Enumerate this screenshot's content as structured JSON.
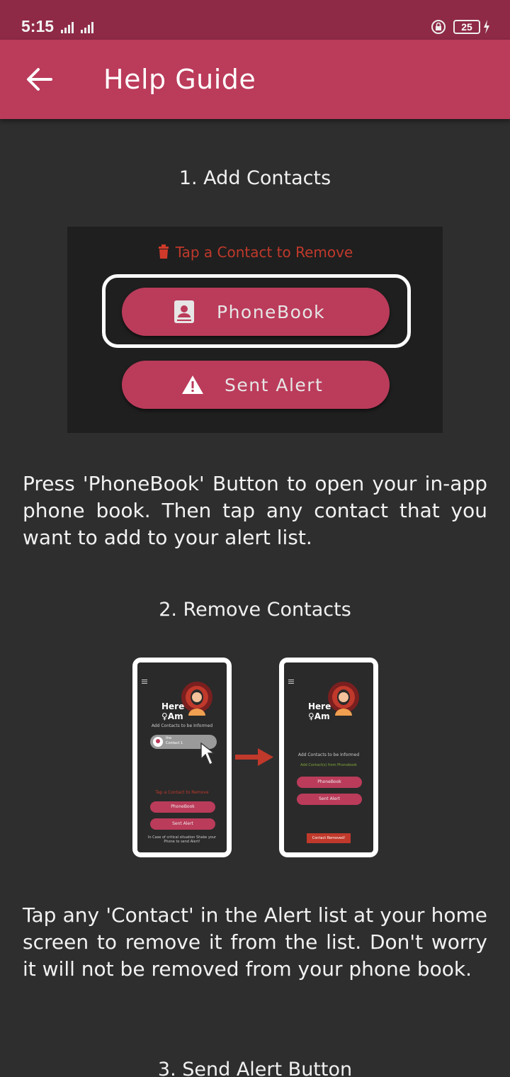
{
  "status": {
    "time": "5:15",
    "battery": "25"
  },
  "appbar": {
    "title": "Help Guide"
  },
  "sections": [
    {
      "heading": "1. Add Contacts",
      "figure": {
        "hint": "Tap a Contact to Remove",
        "phonebook": "PhoneBook",
        "sent_alert": "Sent Alert"
      },
      "text": "Press 'PhoneBook' Button to open your in-app phone book. Then tap any contact that you want to add to your alert list."
    },
    {
      "heading": "2. Remove Contacts",
      "figure": {
        "left": {
          "here": "Here",
          "am": "♀Am",
          "subtitle": "Add Contacts to be Informed",
          "contact_line1": "the",
          "contact_line2": "Contact 1",
          "hint": "Tap a Contact to Remove",
          "phonebook": "PhoneBook",
          "sent_alert": "Sent Alert",
          "footer": "In Case of critical situation Shake your Phone to send Alert!"
        },
        "right": {
          "here": "Here",
          "am": "♀Am",
          "subtitle": "Add Contacts to be Informed",
          "subtitle2": "Add Contact(s) from Phonebook",
          "phonebook": "PhoneBook",
          "sent_alert": "Sent Alert",
          "toast": "Contact Removed!"
        }
      },
      "text": "Tap any 'Contact' in the Alert list at your home screen to remove it from the list. Don't worry it will not be removed from your phone book."
    },
    {
      "heading": "3. Send Alert Button"
    }
  ],
  "colors": {
    "accent": "#bb3b5a",
    "statusbar": "#8e2a46",
    "background": "#2e2e2e"
  }
}
